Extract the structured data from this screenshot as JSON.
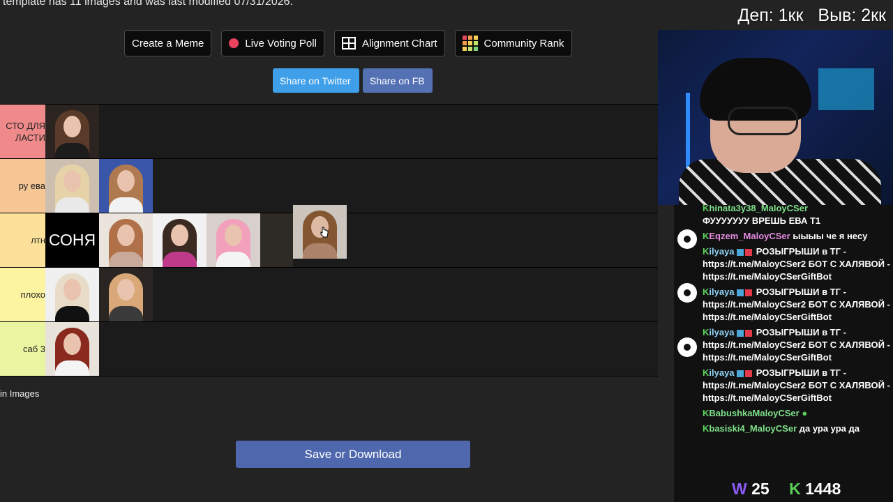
{
  "header": {
    "note": "template has 11 images and was last modified 07/31/2026."
  },
  "toolbar": {
    "create_meme": "Create a Meme",
    "live_voting": "Live Voting Poll",
    "alignment_chart": "Alignment Chart",
    "community_rank": "Community Rank"
  },
  "share": {
    "twitter": "Share on Twitter",
    "fb": "Share on FB"
  },
  "tiers": [
    {
      "label_line1": "СТО ДЛЯ",
      "label_line2": "ЛАСТИ",
      "color": "#f08a8a"
    },
    {
      "label_line1": "ру ева",
      "label_line2": "",
      "color": "#f6c694"
    },
    {
      "label_line1": "лтн",
      "label_line2": "",
      "color": "#fce19a"
    },
    {
      "label_line1": "плохо",
      "label_line2": "",
      "color": "#fdf4a2"
    },
    {
      "label_line1": "саб 3",
      "label_line2": "",
      "color": "#e9f5a0"
    }
  ],
  "text_thumb": "СОНЯ",
  "drag_in_label": "in Images",
  "save_button": "Save or Download",
  "overlay": {
    "dep": "Деп: 1кк",
    "vyv": "Выв: 2кк"
  },
  "chat": {
    "messages": [
      {
        "user": "hinata3y38_MaloyCSer",
        "text": "ФУУУУУУУ ВРЕШЬ ЕВА Т1"
      },
      {
        "user": "Eqzem_MaloyCSer",
        "text": "ыыыы че я несу"
      },
      {
        "user": "ilyaya",
        "text": "РОЗЫГРЫШИ в ТГ - https://t.me/MaloyCSer2 БОТ С ХАЛЯВОЙ - https://t.me/MaloyCSerGiftBot"
      },
      {
        "user": "ilyaya",
        "text": "РОЗЫГРЫШИ в ТГ - https://t.me/MaloyCSer2 БОТ С ХАЛЯВОЙ - https://t.me/MaloyCSerGiftBot"
      },
      {
        "user": "ilyaya",
        "text": "РОЗЫГРЫШИ в ТГ - https://t.me/MaloyCSer2 БОТ С ХАЛЯВОЙ - https://t.me/MaloyCSerGiftBot"
      },
      {
        "user": "ilyaya",
        "text": "РОЗЫГРЫШИ в ТГ - https://t.me/MaloyCSer2 БОТ С ХАЛЯВОЙ - https://t.me/MaloyCSerGiftBot"
      },
      {
        "user": "BabushkaMaloyCSer",
        "text": ""
      },
      {
        "user": "basiski4_MaloyCSer",
        "text": "да ура ура да"
      }
    ],
    "viewers_w": "25",
    "viewers_k": "1448"
  },
  "colors": {
    "save": "#4f68ad",
    "twitter": "#3fa0e9",
    "fb": "#5471b4",
    "accent_red": "#e8425c"
  }
}
